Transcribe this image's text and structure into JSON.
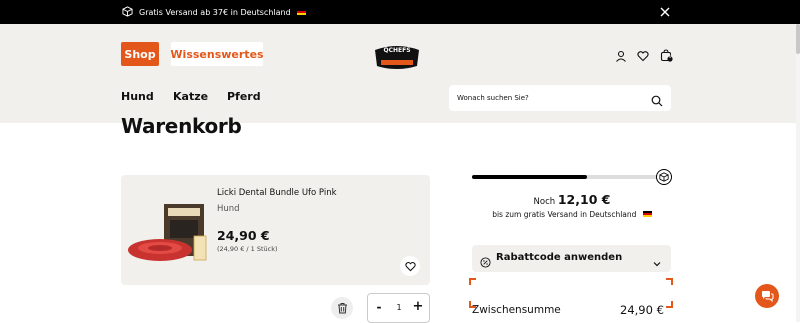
{
  "announcement": {
    "text": "Gratis Versand ab 37€ in Deutschland",
    "icons": [
      "box-icon",
      "germany-flag-icon",
      "close-icon"
    ]
  },
  "header": {
    "shop_label": "Shop",
    "wissenswertes_label": "Wissenswertes",
    "logo_text": "QCHEFS",
    "icons": [
      "user-icon",
      "heart-icon",
      "cart-icon"
    ],
    "cart_count": "1"
  },
  "nav": [
    "Hund",
    "Katze",
    "Pferd"
  ],
  "search": {
    "placeholder": "Wonach suchen Sie?"
  },
  "page": {
    "title": "Warenkorb"
  },
  "cart_item": {
    "name": "Licki Dental Bundle Ufo Pink",
    "category": "Hund",
    "price": "24,90 €",
    "unit_price": "(24,90 € / 1 Stück)",
    "quantity": "1",
    "minus_label": "-",
    "plus_label": "+"
  },
  "shipping": {
    "progress_percent": 60,
    "prefix": "Noch",
    "remaining": "12,10 €",
    "suffix": "bis zum gratis Versand in Deutschland"
  },
  "coupon": {
    "label": "Rabattcode anwenden"
  },
  "summary": {
    "subtotal_label": "Zwischensumme",
    "subtotal_value": "24,90 €"
  },
  "colors": {
    "accent": "#e4571b",
    "header_bg": "#f1f0ec",
    "black": "#000000"
  }
}
